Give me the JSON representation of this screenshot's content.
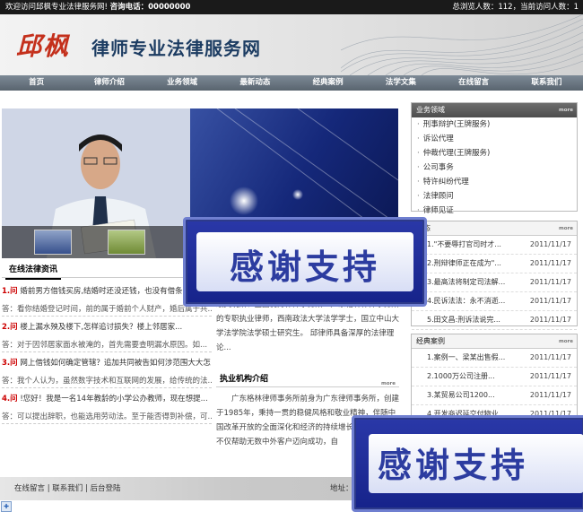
{
  "topbar": {
    "welcome": "欢迎访问邱枫专业法律服务网!",
    "hotline_label": "咨询电话：",
    "hotline": "00000000",
    "stats": "总浏览人数：112，当前访问人数：1"
  },
  "header": {
    "logo_text": "邱枫",
    "site_title": "律师专业法律服务网"
  },
  "nav": [
    "首页",
    "律师介绍",
    "业务领域",
    "最新动态",
    "经典案例",
    "法学文集",
    "在线留言",
    "联系我们"
  ],
  "news": {
    "title": "在线法律资讯",
    "items": [
      {
        "q_num": "1.问",
        "q": "婚前男方借钱买房,结婚时还没还钱，也没有借条什么",
        "a": "答：看你结婚登记时间，前的属于婚前个人财产，婚后属于共..."
      },
      {
        "q_num": "2.问",
        "q": "楼上漏水殃及楼下,怎样追讨损失？楼上邻居家...",
        "a": "答：对于因邻居家面水被淹的，首先需要查明漏水原因。如..."
      },
      {
        "q_num": "3.问",
        "q": "网上借钱如何确定管辖？追加共同被告如何涉范围大大怎",
        "a": "答：我个人认为，虽然数字技术和互联网的发展，给传统的法..."
      },
      {
        "q_num": "4.问",
        "q": "!您好！我是一名14年教龄的小学公办教师，现在想提...",
        "a": "答：可以提出辞职，也能选用劳动法。至于能否得到补偿，可..."
      }
    ]
  },
  "intro": {
    "text": "级文明所、全国优秀律师事务所一广东格林律师事务所的专职执业律师，西南政法大学法学学士，国立中山大学法学院法学硕士研究生。 邱律师具备深厚的法律理论...",
    "org_title": "执业机构介绍",
    "org_more": "more",
    "org_text": "广东格林律师事务所前身为广东律师事务所，创建于1985年，秉持一贯的稳健风格和敬业精神，伴随中国改革开放的全面深化和经济的持续增长，二十余年来不仅帮助无数中外客户迈向成功，自"
  },
  "service_box": {
    "title": "业务领域",
    "more": "more",
    "items": [
      "刑事辩护(王牌服务)",
      "诉讼代理",
      "仲裁代理(王牌服务)",
      "公司事务",
      "特许纠纷代理",
      "法律顾问",
      "律师见证"
    ]
  },
  "dynamic_box": {
    "title": "动态",
    "more": "more",
    "items": [
      {
        "text": "1.\"不要辱打官司时才...",
        "date": "2011/11/17"
      },
      {
        "text": "2.刑辩律师正在成为\"...",
        "date": "2011/11/17"
      },
      {
        "text": "3.最高法将制定司法解...",
        "date": "2011/11/17"
      },
      {
        "text": "4.民诉法法：永不消逝...",
        "date": "2011/11/17"
      },
      {
        "text": "5.田文昌:刑诉法说完...",
        "date": "2011/11/17"
      }
    ]
  },
  "case_box": {
    "title": "经典案例",
    "more": "more",
    "items": [
      {
        "text": "1.案例一、梁某出售假...",
        "date": "2011/11/17"
      },
      {
        "text": "2.1000万公司注册...",
        "date": "2011/11/17"
      },
      {
        "text": "3.某贸易公司1200...",
        "date": "2011/11/17"
      },
      {
        "text": "4.开发商迟延交付物业...",
        "date": "2011/11/17"
      }
    ]
  },
  "footer": {
    "links": "在线留言  |  联系我们  |  后台登陆",
    "address_label": "地址："
  },
  "overlay": {
    "badge_text": "感谢支持"
  }
}
